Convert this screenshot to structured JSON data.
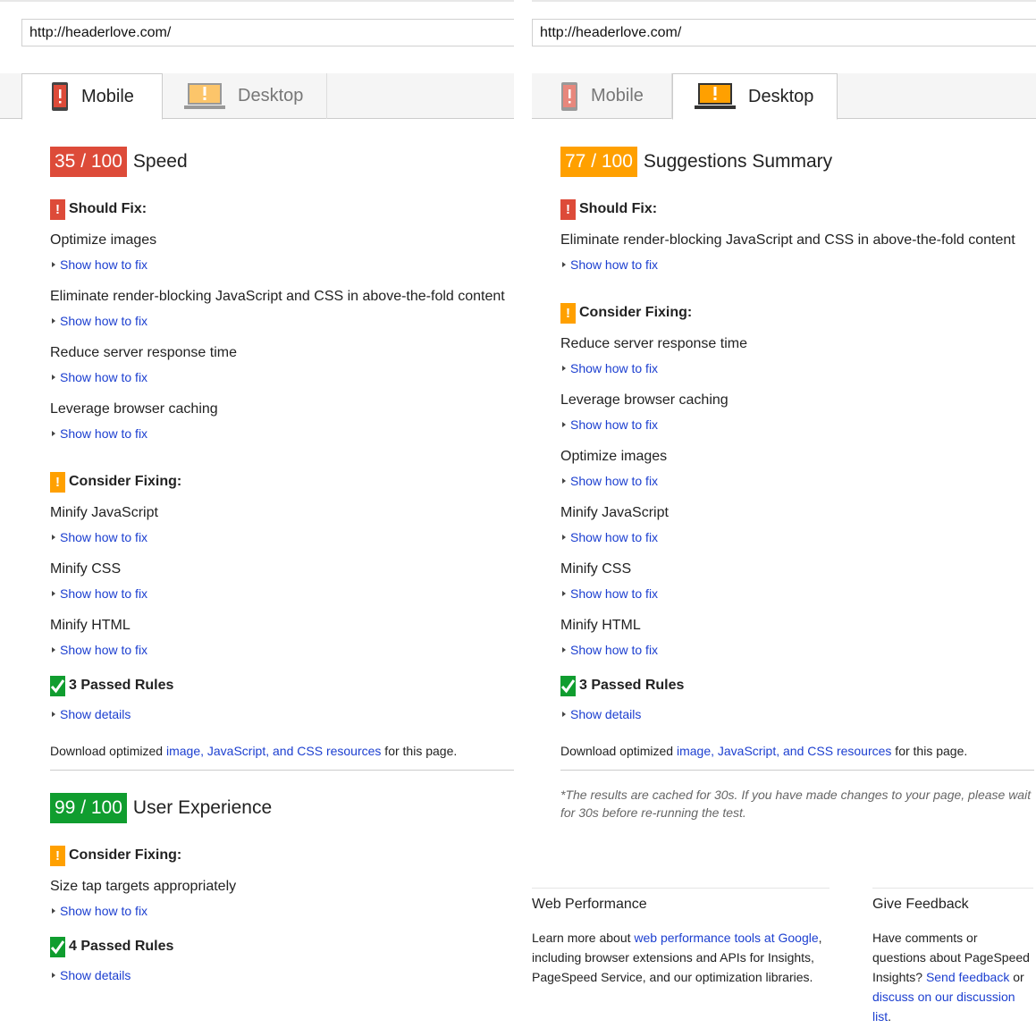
{
  "colors": {
    "red": "#dd4b39",
    "orange": "#ffa000",
    "green": "#109d2f",
    "link": "#1c3fd0"
  },
  "panels": [
    {
      "url": "http://headerlove.com/",
      "tabs": [
        {
          "label": "Mobile",
          "icon": "mobile-phone-icon",
          "active": true
        },
        {
          "label": "Desktop",
          "icon": "laptop-icon",
          "active": false
        }
      ],
      "results": [
        {
          "score": "35 / 100",
          "score_color": "red",
          "title": "Speed",
          "sections": [
            {
              "label": "Should Fix:",
              "icon": "exclamation-icon",
              "color": "red",
              "items": [
                {
                  "title": "Optimize images",
                  "link": "Show how to fix"
                },
                {
                  "title": "Eliminate render-blocking JavaScript and CSS in above-the-fold content",
                  "link": "Show how to fix"
                },
                {
                  "title": "Reduce server response time",
                  "link": "Show how to fix"
                },
                {
                  "title": "Leverage browser caching",
                  "link": "Show how to fix"
                }
              ]
            },
            {
              "label": "Consider Fixing:",
              "icon": "exclamation-icon",
              "color": "orange",
              "items": [
                {
                  "title": "Minify JavaScript",
                  "link": "Show how to fix"
                },
                {
                  "title": "Minify CSS",
                  "link": "Show how to fix"
                },
                {
                  "title": "Minify HTML",
                  "link": "Show how to fix"
                }
              ]
            }
          ],
          "passed": {
            "label": "3 Passed Rules",
            "link": "Show details"
          },
          "download": {
            "prefix": "Download optimized ",
            "link": "image, JavaScript, and CSS resources",
            "suffix": " for this page."
          }
        },
        {
          "score": "99 / 100",
          "score_color": "green",
          "title": "User Experience",
          "sections": [
            {
              "label": "Consider Fixing:",
              "icon": "exclamation-icon",
              "color": "orange",
              "items": [
                {
                  "title": "Size tap targets appropriately",
                  "link": "Show how to fix"
                }
              ]
            }
          ],
          "passed": {
            "label": "4 Passed Rules",
            "link": "Show details"
          }
        }
      ]
    },
    {
      "url": "http://headerlove.com/",
      "tabs": [
        {
          "label": "Mobile",
          "icon": "mobile-phone-icon",
          "active": false
        },
        {
          "label": "Desktop",
          "icon": "laptop-icon",
          "active": true
        }
      ],
      "results": [
        {
          "score": "77 / 100",
          "score_color": "orange",
          "title": "Suggestions Summary",
          "sections": [
            {
              "label": "Should Fix:",
              "icon": "exclamation-icon",
              "color": "red",
              "items": [
                {
                  "title": "Eliminate render-blocking JavaScript and CSS in above-the-fold content",
                  "link": "Show how to fix"
                }
              ]
            },
            {
              "label": "Consider Fixing:",
              "icon": "exclamation-icon",
              "color": "orange",
              "items": [
                {
                  "title": "Reduce server response time",
                  "link": "Show how to fix"
                },
                {
                  "title": "Leverage browser caching",
                  "link": "Show how to fix"
                },
                {
                  "title": "Optimize images",
                  "link": "Show how to fix"
                },
                {
                  "title": "Minify JavaScript",
                  "link": "Show how to fix"
                },
                {
                  "title": "Minify CSS",
                  "link": "Show how to fix"
                },
                {
                  "title": "Minify HTML",
                  "link": "Show how to fix"
                }
              ]
            }
          ],
          "passed": {
            "label": "3 Passed Rules",
            "link": "Show details"
          },
          "download": {
            "prefix": "Download optimized ",
            "link": "image, JavaScript, and CSS resources",
            "suffix": " for this page."
          }
        }
      ],
      "note": "*The results are cached for 30s. If you have made changes to your page, please wait for 30s before re-running the test."
    }
  ],
  "footer": {
    "web_performance": {
      "title": "Web Performance",
      "prefix": "Learn more about ",
      "link": "web performance tools at Google",
      "suffix": ",",
      "line2": "including browser extensions and APIs for Insights,",
      "line3": "PageSpeed Service, and our optimization libraries."
    },
    "feedback": {
      "title": "Give Feedback",
      "line1": "Have comments or questions about PageSpeed",
      "line2_prefix": "Insights? ",
      "link1": "Send feedback",
      "mid": " or ",
      "link2": "discuss on our discussion",
      "link2_end": "list",
      "suffix": "."
    }
  }
}
